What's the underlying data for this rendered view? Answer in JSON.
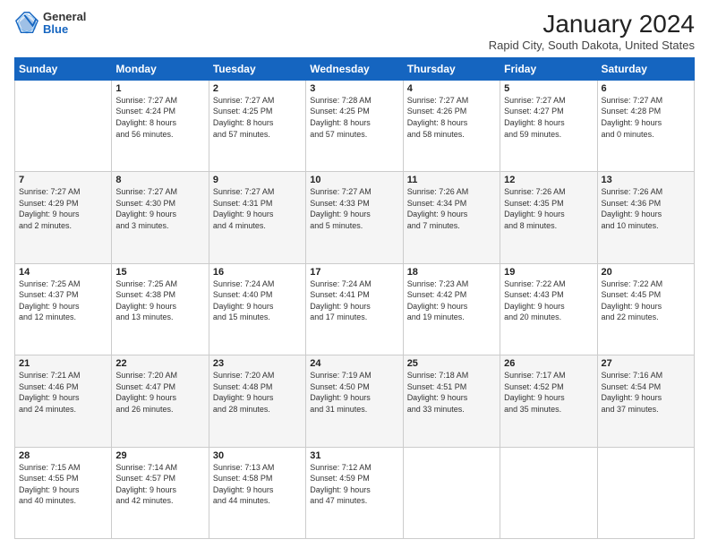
{
  "header": {
    "logo": {
      "general": "General",
      "blue": "Blue"
    },
    "title": "January 2024",
    "subtitle": "Rapid City, South Dakota, United States"
  },
  "calendar": {
    "days_of_week": [
      "Sunday",
      "Monday",
      "Tuesday",
      "Wednesday",
      "Thursday",
      "Friday",
      "Saturday"
    ],
    "weeks": [
      [
        {
          "day": "",
          "info": ""
        },
        {
          "day": "1",
          "info": "Sunrise: 7:27 AM\nSunset: 4:24 PM\nDaylight: 8 hours\nand 56 minutes."
        },
        {
          "day": "2",
          "info": "Sunrise: 7:27 AM\nSunset: 4:25 PM\nDaylight: 8 hours\nand 57 minutes."
        },
        {
          "day": "3",
          "info": "Sunrise: 7:28 AM\nSunset: 4:25 PM\nDaylight: 8 hours\nand 57 minutes."
        },
        {
          "day": "4",
          "info": "Sunrise: 7:27 AM\nSunset: 4:26 PM\nDaylight: 8 hours\nand 58 minutes."
        },
        {
          "day": "5",
          "info": "Sunrise: 7:27 AM\nSunset: 4:27 PM\nDaylight: 8 hours\nand 59 minutes."
        },
        {
          "day": "6",
          "info": "Sunrise: 7:27 AM\nSunset: 4:28 PM\nDaylight: 9 hours\nand 0 minutes."
        }
      ],
      [
        {
          "day": "7",
          "info": "Sunrise: 7:27 AM\nSunset: 4:29 PM\nDaylight: 9 hours\nand 2 minutes."
        },
        {
          "day": "8",
          "info": "Sunrise: 7:27 AM\nSunset: 4:30 PM\nDaylight: 9 hours\nand 3 minutes."
        },
        {
          "day": "9",
          "info": "Sunrise: 7:27 AM\nSunset: 4:31 PM\nDaylight: 9 hours\nand 4 minutes."
        },
        {
          "day": "10",
          "info": "Sunrise: 7:27 AM\nSunset: 4:33 PM\nDaylight: 9 hours\nand 5 minutes."
        },
        {
          "day": "11",
          "info": "Sunrise: 7:26 AM\nSunset: 4:34 PM\nDaylight: 9 hours\nand 7 minutes."
        },
        {
          "day": "12",
          "info": "Sunrise: 7:26 AM\nSunset: 4:35 PM\nDaylight: 9 hours\nand 8 minutes."
        },
        {
          "day": "13",
          "info": "Sunrise: 7:26 AM\nSunset: 4:36 PM\nDaylight: 9 hours\nand 10 minutes."
        }
      ],
      [
        {
          "day": "14",
          "info": "Sunrise: 7:25 AM\nSunset: 4:37 PM\nDaylight: 9 hours\nand 12 minutes."
        },
        {
          "day": "15",
          "info": "Sunrise: 7:25 AM\nSunset: 4:38 PM\nDaylight: 9 hours\nand 13 minutes."
        },
        {
          "day": "16",
          "info": "Sunrise: 7:24 AM\nSunset: 4:40 PM\nDaylight: 9 hours\nand 15 minutes."
        },
        {
          "day": "17",
          "info": "Sunrise: 7:24 AM\nSunset: 4:41 PM\nDaylight: 9 hours\nand 17 minutes."
        },
        {
          "day": "18",
          "info": "Sunrise: 7:23 AM\nSunset: 4:42 PM\nDaylight: 9 hours\nand 19 minutes."
        },
        {
          "day": "19",
          "info": "Sunrise: 7:22 AM\nSunset: 4:43 PM\nDaylight: 9 hours\nand 20 minutes."
        },
        {
          "day": "20",
          "info": "Sunrise: 7:22 AM\nSunset: 4:45 PM\nDaylight: 9 hours\nand 22 minutes."
        }
      ],
      [
        {
          "day": "21",
          "info": "Sunrise: 7:21 AM\nSunset: 4:46 PM\nDaylight: 9 hours\nand 24 minutes."
        },
        {
          "day": "22",
          "info": "Sunrise: 7:20 AM\nSunset: 4:47 PM\nDaylight: 9 hours\nand 26 minutes."
        },
        {
          "day": "23",
          "info": "Sunrise: 7:20 AM\nSunset: 4:48 PM\nDaylight: 9 hours\nand 28 minutes."
        },
        {
          "day": "24",
          "info": "Sunrise: 7:19 AM\nSunset: 4:50 PM\nDaylight: 9 hours\nand 31 minutes."
        },
        {
          "day": "25",
          "info": "Sunrise: 7:18 AM\nSunset: 4:51 PM\nDaylight: 9 hours\nand 33 minutes."
        },
        {
          "day": "26",
          "info": "Sunrise: 7:17 AM\nSunset: 4:52 PM\nDaylight: 9 hours\nand 35 minutes."
        },
        {
          "day": "27",
          "info": "Sunrise: 7:16 AM\nSunset: 4:54 PM\nDaylight: 9 hours\nand 37 minutes."
        }
      ],
      [
        {
          "day": "28",
          "info": "Sunrise: 7:15 AM\nSunset: 4:55 PM\nDaylight: 9 hours\nand 40 minutes."
        },
        {
          "day": "29",
          "info": "Sunrise: 7:14 AM\nSunset: 4:57 PM\nDaylight: 9 hours\nand 42 minutes."
        },
        {
          "day": "30",
          "info": "Sunrise: 7:13 AM\nSunset: 4:58 PM\nDaylight: 9 hours\nand 44 minutes."
        },
        {
          "day": "31",
          "info": "Sunrise: 7:12 AM\nSunset: 4:59 PM\nDaylight: 9 hours\nand 47 minutes."
        },
        {
          "day": "",
          "info": ""
        },
        {
          "day": "",
          "info": ""
        },
        {
          "day": "",
          "info": ""
        }
      ]
    ]
  }
}
